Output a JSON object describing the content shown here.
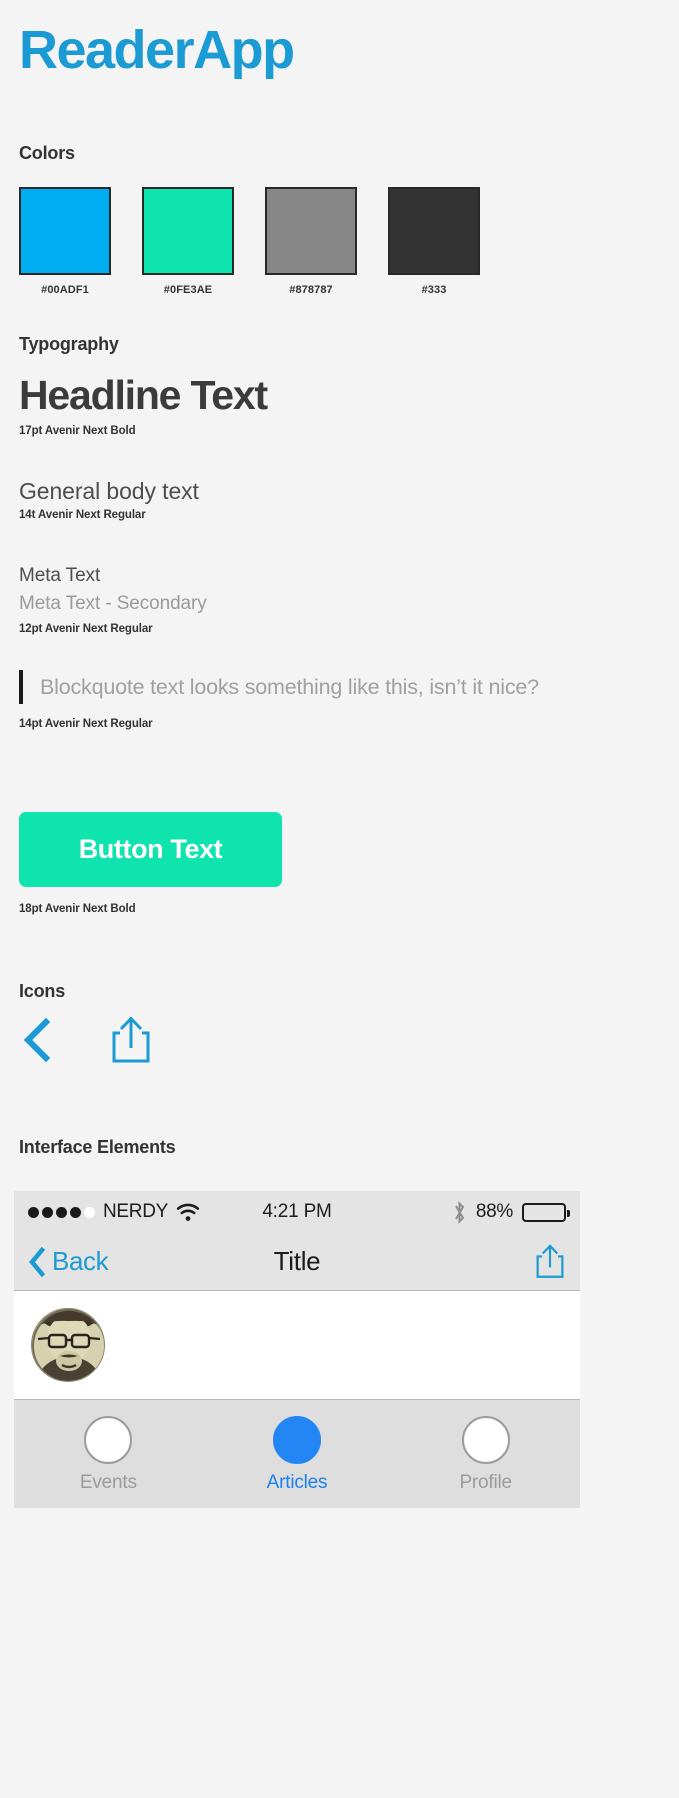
{
  "brand": {
    "title": "ReaderApp",
    "color": "#1b9ad4"
  },
  "sections": {
    "colors": "Colors",
    "typography": "Typography",
    "icons": "Icons",
    "interface": "Interface Elements"
  },
  "colors": {
    "swatches": [
      {
        "hex": "#00ADF1",
        "label": "#00ADF1",
        "name": "primary-blue"
      },
      {
        "hex": "#0FE3AE",
        "label": "#0FE3AE",
        "name": "accent-green"
      },
      {
        "hex": "#878787",
        "label": "#878787",
        "name": "mid-gray"
      },
      {
        "hex": "#333333",
        "label": "#333",
        "name": "dark-gray"
      }
    ]
  },
  "typography": {
    "headline": {
      "sample": "Headline Text",
      "note": "17pt Avenir Next Bold"
    },
    "body": {
      "sample": "General body text",
      "note": "14t Avenir Next Regular"
    },
    "meta": {
      "primary": "Meta Text",
      "secondary": "Meta Text - Secondary",
      "note": "12pt Avenir Next Regular"
    },
    "blockquote": {
      "sample": "Blockquote text looks something like this, isn’t it nice?",
      "note": "14pt Avenir Next Regular"
    },
    "button": {
      "label": "Button Text",
      "note": "18pt Avenir Next Bold"
    }
  },
  "icons": [
    {
      "name": "back-chevron-icon",
      "color": "#1b9ad4"
    },
    {
      "name": "share-icon",
      "color": "#1b9ad4"
    }
  ],
  "device": {
    "statusbar": {
      "carrier": "NERDY",
      "signal_dots_filled": 4,
      "signal_dots_total": 5,
      "wifi": "wifi-icon",
      "time": "4:21 PM",
      "bluetooth": "bluetooth-icon",
      "battery_percent": "88%",
      "battery_level": 88
    },
    "navbar": {
      "back_label": "Back",
      "title": "Title",
      "share": "share-icon"
    },
    "content": {
      "avatar": "user-avatar"
    },
    "tabbar": {
      "tabs": [
        {
          "label": "Events",
          "active": false
        },
        {
          "label": "Articles",
          "active": true
        },
        {
          "label": "Profile",
          "active": false
        }
      ],
      "active_color": "#2486f5"
    }
  }
}
